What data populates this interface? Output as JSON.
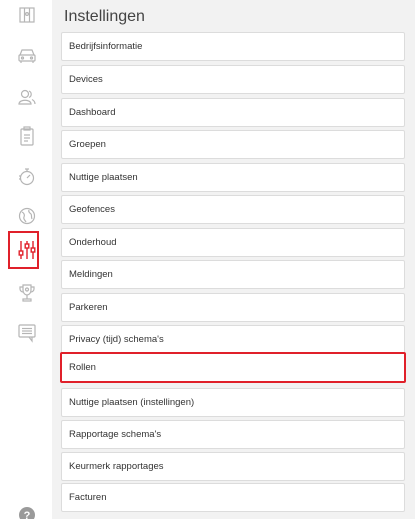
{
  "header": {
    "title": "Instellingen"
  },
  "sidebar": {
    "icons": [
      {
        "name": "map-icon"
      },
      {
        "name": "car-icon"
      },
      {
        "name": "users-icon"
      },
      {
        "name": "clipboard-icon"
      },
      {
        "name": "stopwatch-icon"
      },
      {
        "name": "globe-icon"
      },
      {
        "name": "settings-sliders-icon",
        "active": true
      },
      {
        "name": "trophy-icon"
      },
      {
        "name": "message-icon"
      },
      {
        "name": "help-icon"
      }
    ],
    "active_color": "#e0202a",
    "inactive_color": "#b5b5b5"
  },
  "menu": {
    "items": [
      {
        "label": "Bedrijfsinformatie"
      },
      {
        "label": "Devices"
      },
      {
        "label": "Dashboard"
      },
      {
        "label": "Groepen"
      },
      {
        "label": "Nuttige plaatsen"
      },
      {
        "label": "Geofences"
      },
      {
        "label": "Onderhoud"
      },
      {
        "label": "Meldingen"
      },
      {
        "label": "Parkeren"
      },
      {
        "label": "Privacy (tijd) schema's"
      },
      {
        "label": "Rollen",
        "selected": true
      },
      {
        "label": "Nuttige plaatsen (instellingen)"
      },
      {
        "label": "Rapportage schema's"
      },
      {
        "label": "Keurmerk rapportages"
      },
      {
        "label": "Facturen"
      }
    ]
  }
}
